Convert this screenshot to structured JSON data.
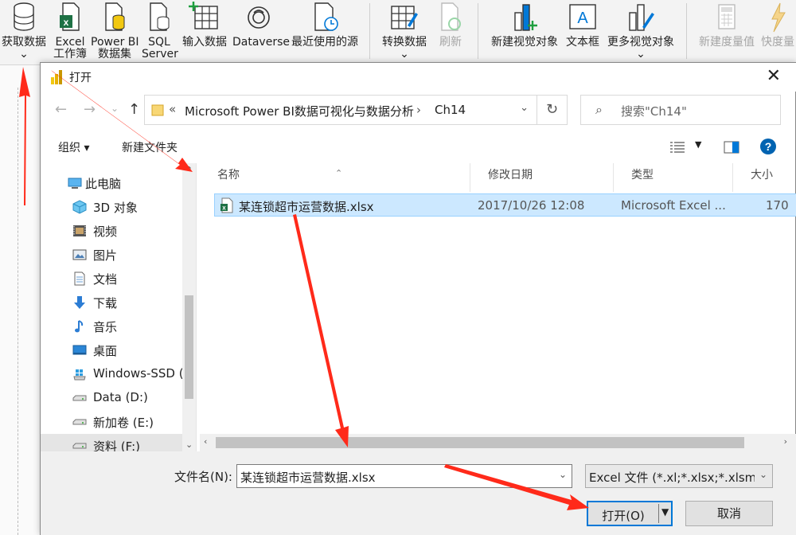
{
  "ribbon": {
    "items": [
      {
        "id": "get-data",
        "line1": "获取数据",
        "line2": "⌄",
        "icon": "database-icon"
      },
      {
        "id": "excel",
        "line1": "Excel",
        "line2": "工作簿",
        "icon": "excel-icon"
      },
      {
        "id": "powerbi",
        "line1": "Power BI",
        "line2": "数据集",
        "icon": "dataset-icon"
      },
      {
        "id": "sql",
        "line1": "SQL",
        "line2": "Server",
        "icon": "sql-server-icon"
      },
      {
        "id": "enter-data",
        "line1": "输入数据",
        "line2": "",
        "icon": "table-icon"
      },
      {
        "id": "dataverse",
        "line1": "Dataverse",
        "line2": "",
        "icon": "dataverse-icon"
      },
      {
        "id": "recent",
        "line1": "最近使用的源",
        "line2": "",
        "icon": "recent-sources-icon"
      },
      {
        "id": "transform",
        "line1": "转换数据",
        "line2": "⌄",
        "icon": "transform-icon"
      },
      {
        "id": "refresh",
        "line1": "刷新",
        "line2": "",
        "icon": "refresh-icon"
      },
      {
        "id": "new-visual",
        "line1": "新建视觉对象",
        "line2": "",
        "icon": "new-visual-icon"
      },
      {
        "id": "textbox",
        "line1": "文本框",
        "line2": "",
        "icon": "textbox-icon"
      },
      {
        "id": "more-visuals",
        "line1": "更多视觉对象",
        "line2": "⌄",
        "icon": "more-visuals-icon"
      },
      {
        "id": "new-measure",
        "line1": "新建度量值",
        "line2": "",
        "icon": "calculator-icon"
      },
      {
        "id": "quick-measure",
        "line1": "快度量",
        "line2": "",
        "icon": "quick-measure-icon"
      }
    ]
  },
  "dialog": {
    "title": "打开",
    "close": "✕",
    "address": {
      "overflow": "«",
      "segments": [
        "Microsoft Power BI数据可视化与数据分析",
        "Ch14"
      ],
      "separator": "›"
    },
    "search_placeholder": "搜索\"Ch14\"",
    "toolbar": {
      "organize": "组织 ▾",
      "new_folder": "新建文件夹"
    },
    "tree": [
      {
        "label": "此电脑",
        "icon": "computer-icon",
        "root": true
      },
      {
        "label": "3D 对象",
        "icon": "3d-objects-icon"
      },
      {
        "label": "视频",
        "icon": "video-icon"
      },
      {
        "label": "图片",
        "icon": "pictures-icon"
      },
      {
        "label": "文档",
        "icon": "documents-icon"
      },
      {
        "label": "下载",
        "icon": "download-icon"
      },
      {
        "label": "音乐",
        "icon": "music-icon"
      },
      {
        "label": "桌面",
        "icon": "desktop-icon"
      },
      {
        "label": "Windows-SSD (",
        "icon": "windows-drive-icon"
      },
      {
        "label": "Data (D:)",
        "icon": "drive-icon"
      },
      {
        "label": "新加卷 (E:)",
        "icon": "drive-icon"
      },
      {
        "label": "资料 (F:)",
        "icon": "drive-icon",
        "selected": true
      }
    ],
    "columns": [
      "名称",
      "修改日期",
      "类型",
      "大小"
    ],
    "files": [
      {
        "name": "某连锁超市运营数据.xlsx",
        "modified": "2017/10/26 12:08",
        "type": "Microsoft Excel ...",
        "size": "170"
      }
    ],
    "filename_label": "文件名(N):",
    "filename_value": "某连锁超市运营数据.xlsx",
    "filetype_value": "Excel 文件 (*.xl;*.xlsx;*.xlsm;*.",
    "open_label": "打开(O)",
    "cancel_label": "取消"
  },
  "colors": {
    "accent": "#0078d7",
    "selection": "#cce8ff",
    "arrow": "#ff2a1a",
    "excel_green": "#1e7145"
  }
}
